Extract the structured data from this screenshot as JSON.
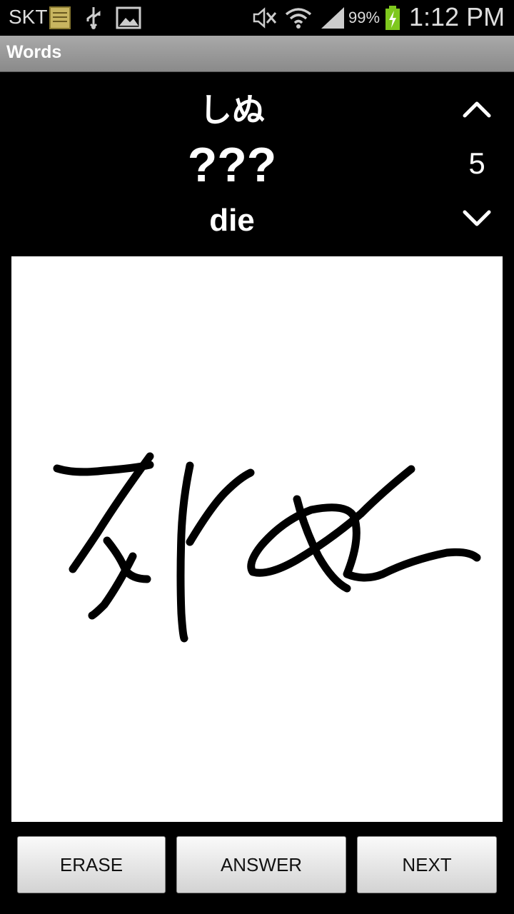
{
  "status_bar": {
    "carrier": "SKT",
    "battery_percent": "99%",
    "time": "1:12 PM",
    "icons": [
      "notes-icon",
      "usb-icon",
      "image-icon",
      "mute-icon",
      "wifi-icon",
      "signal-icon",
      "battery-charging-icon"
    ]
  },
  "titlebar": {
    "title": "Words"
  },
  "card": {
    "kana": "しぬ",
    "kanji": "???",
    "meaning": "die",
    "count": "5"
  },
  "buttons": {
    "erase": "ERASE",
    "answer": "ANSWER",
    "next": "NEXT"
  },
  "colors": {
    "background": "#000000",
    "canvas": "#ffffff",
    "titlebar": "#9a9a9a",
    "battery_charge": "#7ec81e"
  }
}
